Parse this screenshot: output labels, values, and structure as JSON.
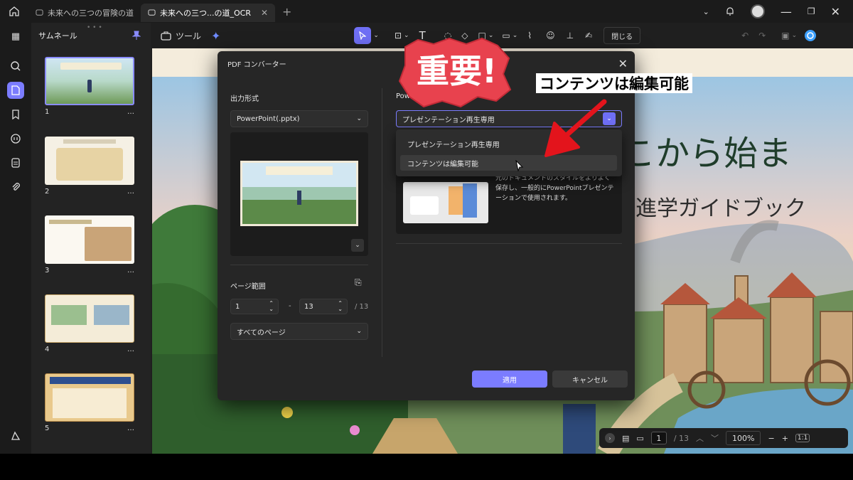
{
  "titlebar": {
    "tabs": [
      {
        "label": "未来への三つの冒険の道",
        "active": false
      },
      {
        "label": "未来への三つ...の道_OCR",
        "active": true
      }
    ]
  },
  "thumbnails": {
    "title": "サムネール",
    "pages": [
      {
        "num": "1",
        "more": "…"
      },
      {
        "num": "2",
        "more": "…"
      },
      {
        "num": "3",
        "more": "…"
      },
      {
        "num": "4",
        "more": "…"
      },
      {
        "num": "5",
        "more": "…"
      }
    ]
  },
  "toolbar": {
    "tools_label": "ツール",
    "close_label": "閉じる"
  },
  "document": {
    "title_fragment": "こから始ま",
    "subtitle_fragment": "進学ガイドブック"
  },
  "status": {
    "current_page": "1",
    "total_pages": "/ 13",
    "zoom": "100%"
  },
  "modal": {
    "title": "PDF コンバーター",
    "output_format_label": "出力形式",
    "format_value": "PowerPoint(.pptx)",
    "right_label": "Powe",
    "mode_value": "プレゼンテーション再生専用",
    "dropdown_options": [
      "プレゼンテーション再生専用",
      "コンテンツは編集可能"
    ],
    "description": "元のドキュメントのスタイルをよりよく保存し、一般的にPowerPointプレゼンテーションで使用されます。",
    "page_range_label": "ページ範囲",
    "range_from": "1",
    "range_dash": "-",
    "range_to": "13",
    "range_total": "/ 13",
    "page_subset": "すべてのページ",
    "apply_label": "適用",
    "cancel_label": "キャンセル"
  },
  "overlay": {
    "callout_text": "コンテンツは編集可能",
    "stamp_text": "重要!"
  },
  "colors": {
    "accent": "#7b7cff",
    "stamp_red": "#e8424e",
    "arrow_red": "#e3141c"
  }
}
